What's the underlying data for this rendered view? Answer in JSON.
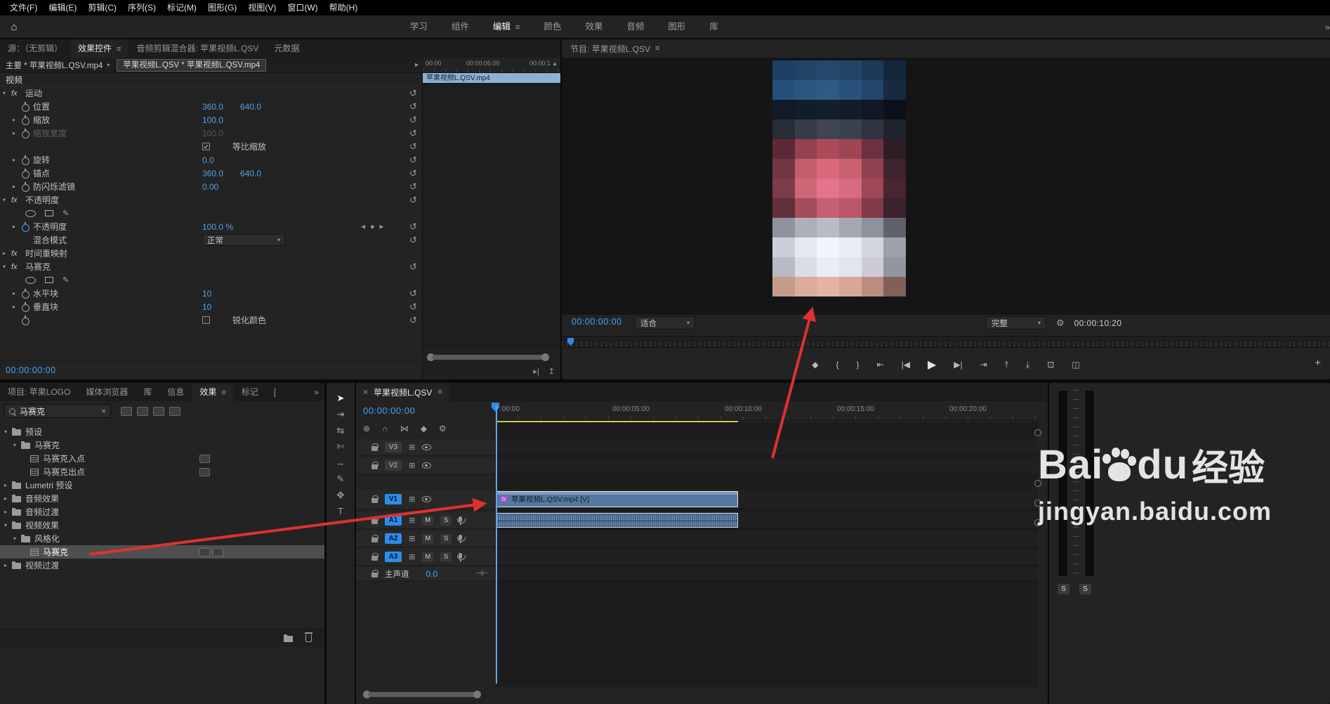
{
  "icons": {
    "home": "⌂",
    "menu": "≡",
    "overflow": "»",
    "close": "×",
    "chevron_down": "▾",
    "chevron_right": "▸",
    "collapse_up": "▲",
    "reset": "↺",
    "sync_lock": "⊞",
    "kf_prev": "◀",
    "kf_add": "◆",
    "kf_next": "▶",
    "wrench": "⚙",
    "plus": "+",
    "clip_nav": "▸",
    "play_mini": "▸|",
    "pan_up": "↥",
    "master_kf": "⊣⊢",
    "search_clear": "×"
  },
  "colors": {
    "accent_blue": "#2d8ceb",
    "value_blue": "#54a0e4",
    "timecode_blue": "#45a3f2",
    "clip_blue": "#54789f",
    "annotation_red": "#e03030",
    "work_area_yellow": "#dcc84f"
  },
  "menubar": {
    "items": [
      "文件(F)",
      "编辑(E)",
      "剪辑(C)",
      "序列(S)",
      "标记(M)",
      "图形(G)",
      "视图(V)",
      "窗口(W)",
      "帮助(H)"
    ]
  },
  "workspace": {
    "tabs": [
      {
        "label": "学习",
        "active": false
      },
      {
        "label": "组件",
        "active": false
      },
      {
        "label": "编辑",
        "active": true
      },
      {
        "label": "颜色",
        "active": false
      },
      {
        "label": "效果",
        "active": false
      },
      {
        "label": "音频",
        "active": false
      },
      {
        "label": "图形",
        "active": false
      },
      {
        "label": "库",
        "active": false
      }
    ],
    "overflow_icon": "»"
  },
  "effect_controls": {
    "tabs": [
      {
        "label": "源：（无剪辑）",
        "active": false
      },
      {
        "label": "效果控件",
        "active": true
      },
      {
        "label": "音频剪辑混合器: 苹果视频L.QSV",
        "active": false
      },
      {
        "label": "元数据",
        "active": false
      }
    ],
    "master_clip": "主要 * 苹果视频L.QSV.mp4",
    "current_clip": "苹果视频L.QSV * 苹果视频L.QSV.mp4",
    "rows": [
      {
        "type": "section",
        "name": "视频"
      },
      {
        "type": "group",
        "chevron": "open",
        "name": "运动",
        "reset": true
      },
      {
        "type": "param",
        "stopwatch": true,
        "name": "位置",
        "values": [
          "360.0",
          "640.0"
        ],
        "reset": true
      },
      {
        "type": "param",
        "chevron": "closed",
        "stopwatch": true,
        "name": "缩放",
        "values": [
          "100.0"
        ],
        "reset": true
      },
      {
        "type": "param",
        "chevron": "closed",
        "stopwatch": true,
        "name": "缩放宽度",
        "values": [
          "100.0"
        ],
        "disabled": true,
        "reset": true
      },
      {
        "type": "checkbox",
        "label": "等比缩放",
        "checked": true,
        "reset": true
      },
      {
        "type": "param",
        "chevron": "closed",
        "stopwatch": true,
        "name": "旋转",
        "values": [
          "0.0"
        ],
        "reset": true
      },
      {
        "type": "param",
        "stopwatch": true,
        "name": "锚点",
        "values": [
          "360.0",
          "640.0"
        ],
        "reset": true
      },
      {
        "type": "param",
        "chevron": "closed",
        "stopwatch": true,
        "name": "防闪烁滤镜",
        "values": [
          "0.00"
        ],
        "reset": true
      },
      {
        "type": "group",
        "chevron": "open",
        "name": "不透明度",
        "reset": true
      },
      {
        "type": "shapes"
      },
      {
        "type": "param",
        "chevron": "closed",
        "stopwatch": true,
        "stopwatch_active": true,
        "name": "不透明度",
        "values": [
          "100.0 %"
        ],
        "keynav": true,
        "reset": true
      },
      {
        "type": "dropdown",
        "name": "混合模式",
        "value": "正常",
        "reset": true
      },
      {
        "type": "group",
        "chevron": "closed",
        "name": "时间重映射",
        "reset": false
      },
      {
        "type": "group",
        "chevron": "open",
        "name": "马赛克",
        "reset": true
      },
      {
        "type": "shapes"
      },
      {
        "type": "param",
        "chevron": "closed",
        "stopwatch": true,
        "name": "水平块",
        "values": [
          "10"
        ],
        "reset": true
      },
      {
        "type": "param",
        "chevron": "closed",
        "stopwatch": true,
        "name": "垂直块",
        "values": [
          "10"
        ],
        "reset": true
      },
      {
        "type": "checkbox",
        "stopwatch": true,
        "label": "锐化颜色",
        "checked": false,
        "reset": true
      }
    ],
    "mini_ruler": [
      "00:00",
      "00:00:05:00",
      "00:00:1"
    ],
    "mini_clip": "苹果视频L.QSV.mp4",
    "timecode": "00:00:00:00"
  },
  "program": {
    "title": "节目: 苹果视频L.QSV",
    "timecode": "00:00:00:00",
    "zoom_level": "适合",
    "playback_resolution": "完整",
    "duration": "00:00:10:20",
    "transport": [
      {
        "name": "add-marker",
        "glyph": "◆"
      },
      {
        "name": "mark-in",
        "glyph": "{"
      },
      {
        "name": "mark-out",
        "glyph": "}"
      },
      {
        "name": "go-to-in",
        "glyph": "⇤"
      },
      {
        "name": "step-back",
        "glyph": "|◀"
      },
      {
        "name": "play",
        "glyph": "▶"
      },
      {
        "name": "step-forward",
        "glyph": "▶|"
      },
      {
        "name": "go-to-out",
        "glyph": "⇥"
      },
      {
        "name": "lift",
        "glyph": "⤒"
      },
      {
        "name": "extract",
        "glyph": "⤓"
      },
      {
        "name": "export-frame",
        "glyph": "⊡"
      },
      {
        "name": "comparison-view",
        "glyph": "◫"
      }
    ],
    "add_button": "+",
    "mosaic": [
      [
        "#1e3f63",
        "#204366",
        "#25496c",
        "#224565",
        "#1c3a57",
        "#13273c"
      ],
      [
        "#26507a",
        "#2b577f",
        "#2e5b83",
        "#29527b",
        "#23456b",
        "#172a40"
      ],
      [
        "#101a28",
        "#121d2b",
        "#141f2e",
        "#121c2a",
        "#0f1824",
        "#0b111b"
      ],
      [
        "#272c37",
        "#353b48",
        "#3f4552",
        "#3b404d",
        "#2f3440",
        "#1f232c"
      ],
      [
        "#5d2937",
        "#944150",
        "#ab4b59",
        "#9f4553",
        "#6b3141",
        "#2f1c25"
      ],
      [
        "#723542",
        "#c35d6d",
        "#d7697a",
        "#ca6171",
        "#8e4251",
        "#3d232d"
      ],
      [
        "#7d3c49",
        "#d06779",
        "#e3748a",
        "#d86b7f",
        "#9e4756",
        "#49252f"
      ],
      [
        "#5f303b",
        "#a64d5c",
        "#c66071",
        "#b95767",
        "#7f3b47",
        "#3b222c"
      ],
      [
        "#8f939d",
        "#acb0ba",
        "#b8bcc6",
        "#a4a8b2",
        "#8e929c",
        "#5e626a"
      ],
      [
        "#cccfd9",
        "#e5e8f2",
        "#f1f4fc",
        "#e9ecf6",
        "#d3d6e0",
        "#9ea1ab"
      ],
      [
        "#b8bbc5",
        "#dadde7",
        "#eaedf7",
        "#e2e5ef",
        "#ccccd9",
        "#92959f"
      ],
      [
        "#c59b8b",
        "#dbab9b",
        "#e3b3a3",
        "#d7a797",
        "#bb8d7f",
        "#7f6157"
      ]
    ]
  },
  "project": {
    "tabs": [
      {
        "label": "项目: 苹果LOGO",
        "active": false
      },
      {
        "label": "媒体浏览器",
        "active": false
      },
      {
        "label": "库",
        "active": false
      },
      {
        "label": "信息",
        "active": false
      },
      {
        "label": "效果",
        "active": true
      },
      {
        "label": "标记",
        "active": false
      },
      {
        "label": "[",
        "active": false
      }
    ],
    "overflow_icon": "»",
    "search_value": "马赛克",
    "filter_icons": [
      "filter-accelerated-icon",
      "filter-32bit-icon",
      "filter-yuv-icon",
      "new-custom-bin-icon"
    ],
    "tree": [
      {
        "indent": 0,
        "chevron": "open",
        "icon": "folder",
        "label": "预设"
      },
      {
        "indent": 1,
        "chevron": "open",
        "icon": "folder",
        "label": "马赛克"
      },
      {
        "indent": 2,
        "chevron": "none",
        "icon": "preset",
        "label": "马赛克入点",
        "badges": 1
      },
      {
        "indent": 2,
        "chevron": "none",
        "icon": "preset",
        "label": "马赛克出点",
        "badges": 1
      },
      {
        "indent": 0,
        "chevron": "closed",
        "icon": "folder",
        "label": "Lumetri 预设"
      },
      {
        "indent": 0,
        "chevron": "closed",
        "icon": "folder",
        "label": "音频效果"
      },
      {
        "indent": 0,
        "chevron": "closed",
        "icon": "folder",
        "label": "音频过渡"
      },
      {
        "indent": 0,
        "chevron": "open",
        "icon": "folder",
        "label": "视频效果"
      },
      {
        "indent": 1,
        "chevron": "open",
        "icon": "folder",
        "label": "风格化"
      },
      {
        "indent": 2,
        "chevron": "none",
        "icon": "effect",
        "label": "马赛克",
        "selected": true,
        "badges": 2
      },
      {
        "indent": 0,
        "chevron": "closed",
        "icon": "folder",
        "label": "视频过渡"
      }
    ]
  },
  "tools": [
    {
      "name": "selection-tool",
      "glyph": "➤",
      "active": true
    },
    {
      "name": "track-select-tool",
      "glyph": "⇥",
      "active": false
    },
    {
      "name": "ripple-edit-tool",
      "glyph": "⇆",
      "active": false
    },
    {
      "name": "razor-tool",
      "glyph": "✄",
      "active": false
    },
    {
      "name": "slip-tool",
      "glyph": "↔",
      "active": false
    },
    {
      "name": "pen-tool",
      "glyph": "✎",
      "active": false
    },
    {
      "name": "hand-tool",
      "glyph": "✥",
      "active": false
    },
    {
      "name": "type-tool",
      "glyph": "T",
      "active": false
    }
  ],
  "timeline": {
    "close_icon": "×",
    "tab": "苹果视频L.QSV",
    "timecode": "00:00:00:00",
    "toolbar": [
      {
        "name": "nest-insert-icon",
        "glyph": "⊕"
      },
      {
        "name": "snap-icon",
        "glyph": "∩"
      },
      {
        "name": "linked-selection-icon",
        "glyph": "⋈"
      },
      {
        "name": "add-marker-icon",
        "glyph": "◆"
      },
      {
        "name": "timeline-settings-icon",
        "glyph": "⚙"
      }
    ],
    "ruler_labels": [
      ":00:00",
      "00:00:05:00",
      "00:00:10:00",
      "00:00:15:00",
      "00:00:20:00"
    ],
    "video_tracks": [
      {
        "label": "V3",
        "targeted": false
      },
      {
        "label": "V2",
        "targeted": false
      },
      {
        "label": "V1",
        "targeted": true,
        "clip_label": "苹果视频L.QSV.mp4 [V]"
      }
    ],
    "audio_tracks": [
      {
        "label": "A1",
        "targeted": true,
        "has_clip": true
      },
      {
        "label": "A2",
        "targeted": true,
        "has_clip": false
      },
      {
        "label": "A3",
        "targeted": true,
        "has_clip": false
      }
    ],
    "master_track": {
      "label": "主声道",
      "value": "0.0"
    },
    "mute_label": "M",
    "solo_label": "S"
  },
  "meters": {
    "solo_labels": [
      "S",
      "S"
    ]
  },
  "watermark": {
    "brand_left": "Bai",
    "brand_right": "du",
    "brand_cn": "经验",
    "url": "jingyan.baidu.com"
  }
}
